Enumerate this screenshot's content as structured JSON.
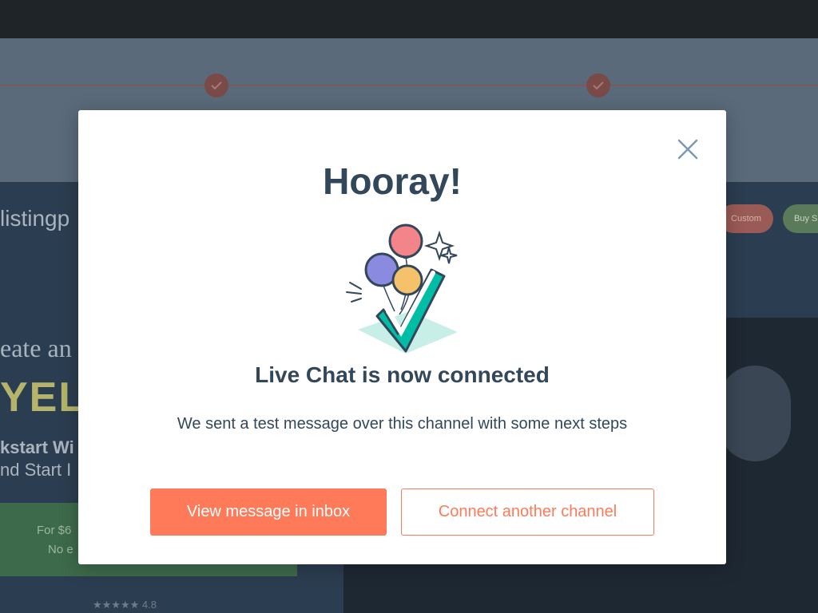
{
  "background": {
    "logo_text": "listingp",
    "custom_button": "Custom",
    "buy_button": "Buy S",
    "headline_part1": "eate an \"",
    "headline_part2": "YELL",
    "subline1": "kstart Wi",
    "subline2": "nd Start I",
    "cta_line1": "For $6",
    "cta_line2": "No e",
    "rating_text": "★★★★★ 4.8",
    "step_check_icon": "checkmark-icon"
  },
  "modal": {
    "title": "Hooray!",
    "heading": "Live Chat is now connected",
    "description": "We sent a test message over this channel with some next steps",
    "primary_button": "View message in inbox",
    "secondary_button": "Connect another channel",
    "close_icon": "close-icon",
    "illustration": "balloons-checkmark-illustration"
  },
  "colors": {
    "accent": "#ff7a59",
    "text_dark": "#33475b",
    "teal": "#00bda5",
    "balloon_red": "#f2545b",
    "balloon_purple": "#7c98f6",
    "balloon_yellow": "#f5c26b"
  }
}
